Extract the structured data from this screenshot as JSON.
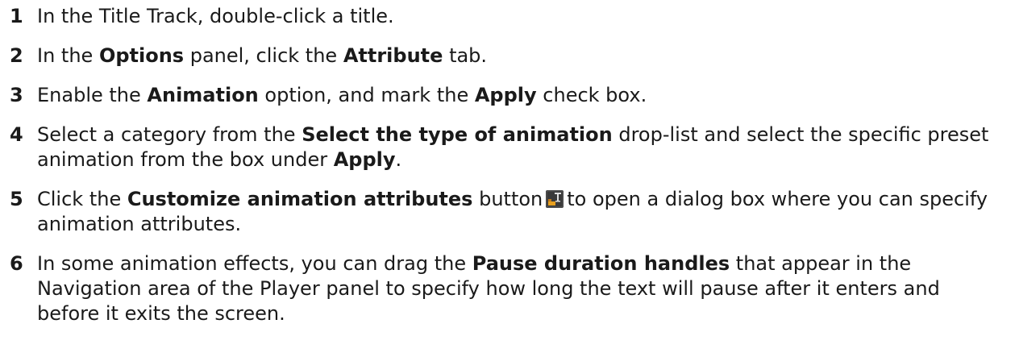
{
  "steps": [
    {
      "number": "1",
      "t1": "In the Title Track, double-click a title."
    },
    {
      "number": "2",
      "t1": "In the ",
      "b1": "Options",
      "t2": " panel, click the ",
      "b2": "Attribute",
      "t3": " tab."
    },
    {
      "number": "3",
      "t1": "Enable the ",
      "b1": "Animation",
      "t2": " option, and mark the ",
      "b2": "Apply",
      "t3": " check box."
    },
    {
      "number": "4",
      "t1": "Select a category from the ",
      "b1": "Select the type of animation",
      "t2": " drop-list and select the specific preset animation from the box under ",
      "b2": "Apply",
      "t3": "."
    },
    {
      "number": "5",
      "t1": "Click the ",
      "b1": "Customize animation attributes",
      "t2": " button",
      "icon": "customize-animation-icon",
      "t3": "to open a dialog box where you can specify animation attributes."
    },
    {
      "number": "6",
      "t1": "In some animation effects, you can drag the ",
      "b1": "Pause duration handles",
      "t2": " that appear in the Navigation area of the Player panel to specify how long the text will pause after it enters and before it exits the screen."
    }
  ],
  "colors": {
    "text": "#1a1a1a",
    "icon_bg": "#3a3a3a",
    "icon_accent": "#e8a020"
  }
}
